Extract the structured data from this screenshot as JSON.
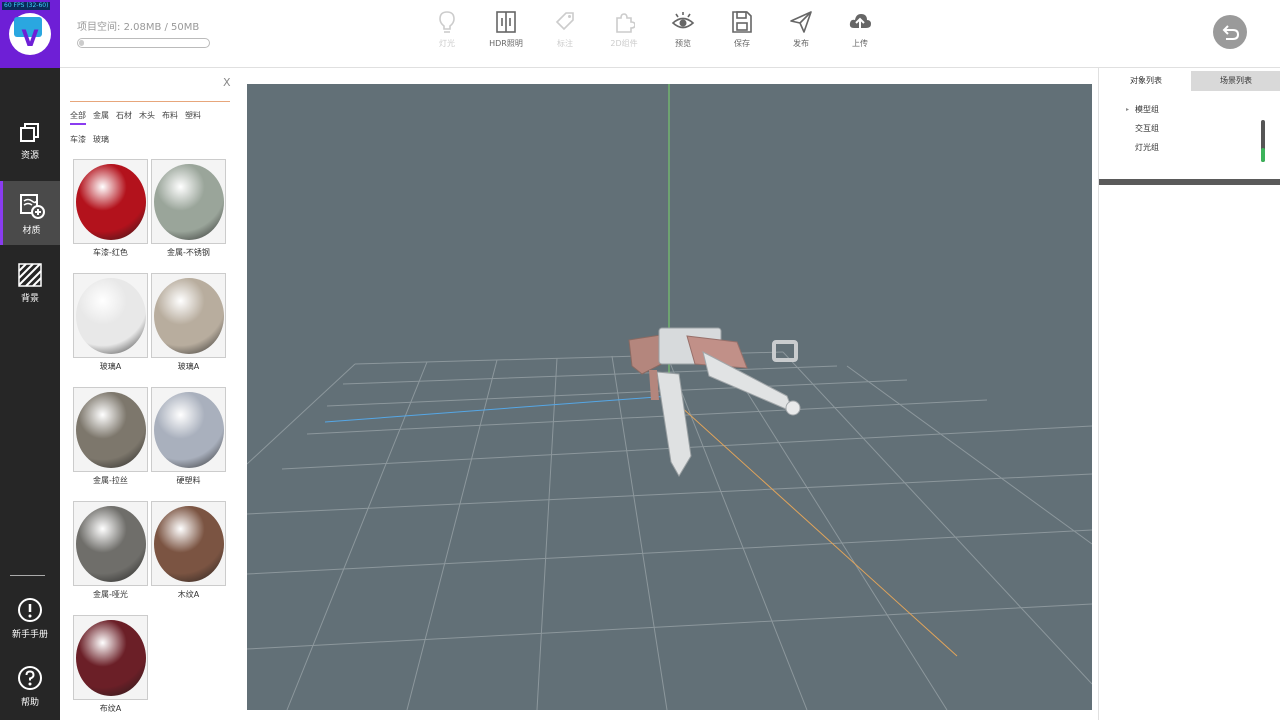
{
  "fps": "60 FPS (32-60)",
  "nav": {
    "items": [
      {
        "label": "资源",
        "icon": "layers-icon"
      },
      {
        "label": "材质",
        "icon": "material-edit-icon"
      },
      {
        "label": "背景",
        "icon": "hatch-background-icon"
      }
    ],
    "bottom": [
      {
        "label": "新手手册",
        "icon": "info-icon"
      },
      {
        "label": "帮助",
        "icon": "help-icon"
      }
    ]
  },
  "topbar": {
    "space_label": "项目空间:",
    "space_value": "2.08MB / 50MB",
    "space_used_fraction": 0.04,
    "tools": [
      {
        "label": "灯光",
        "icon": "bulb-icon",
        "enabled": false
      },
      {
        "label": "HDR照明",
        "icon": "hdr-icon",
        "enabled": true
      },
      {
        "label": "标注",
        "icon": "tag-icon",
        "enabled": false
      },
      {
        "label": "2D组件",
        "icon": "puzzle-icon",
        "enabled": false
      },
      {
        "label": "预览",
        "icon": "eye-icon",
        "enabled": true
      },
      {
        "label": "保存",
        "icon": "save-icon",
        "enabled": true
      },
      {
        "label": "发布",
        "icon": "send-icon",
        "enabled": true
      },
      {
        "label": "上传",
        "icon": "cloud-upload-icon",
        "enabled": true
      }
    ],
    "back_icon": "back-arrow-icon"
  },
  "materials": {
    "close": "X",
    "categories": [
      "全部",
      "金属",
      "石材",
      "木头",
      "布料",
      "塑料",
      "车漆",
      "玻璃"
    ],
    "active_category": "全部",
    "items": [
      {
        "label": "车漆-红色",
        "color": "#b3121c"
      },
      {
        "label": "金属-不锈钢",
        "color": "#9aa59a"
      },
      {
        "label": "玻璃A",
        "color": "#e8e8e8"
      },
      {
        "label": "玻璃A",
        "color": "#b8ad9e"
      },
      {
        "label": "金属-拉丝",
        "color": "#7d776c"
      },
      {
        "label": "硬塑料",
        "color": "#a9b0bd"
      },
      {
        "label": "金属-哑光",
        "color": "#6f6e6a"
      },
      {
        "label": "木纹A",
        "color": "#7b5442"
      },
      {
        "label": "布纹A",
        "color": "#6b1f27"
      }
    ]
  },
  "right": {
    "tabs": [
      "对象列表",
      "场景列表"
    ],
    "tree": [
      {
        "label": "模型组",
        "expandable": true
      },
      {
        "label": "交互组",
        "expandable": false
      },
      {
        "label": "灯光组",
        "expandable": false
      }
    ]
  }
}
